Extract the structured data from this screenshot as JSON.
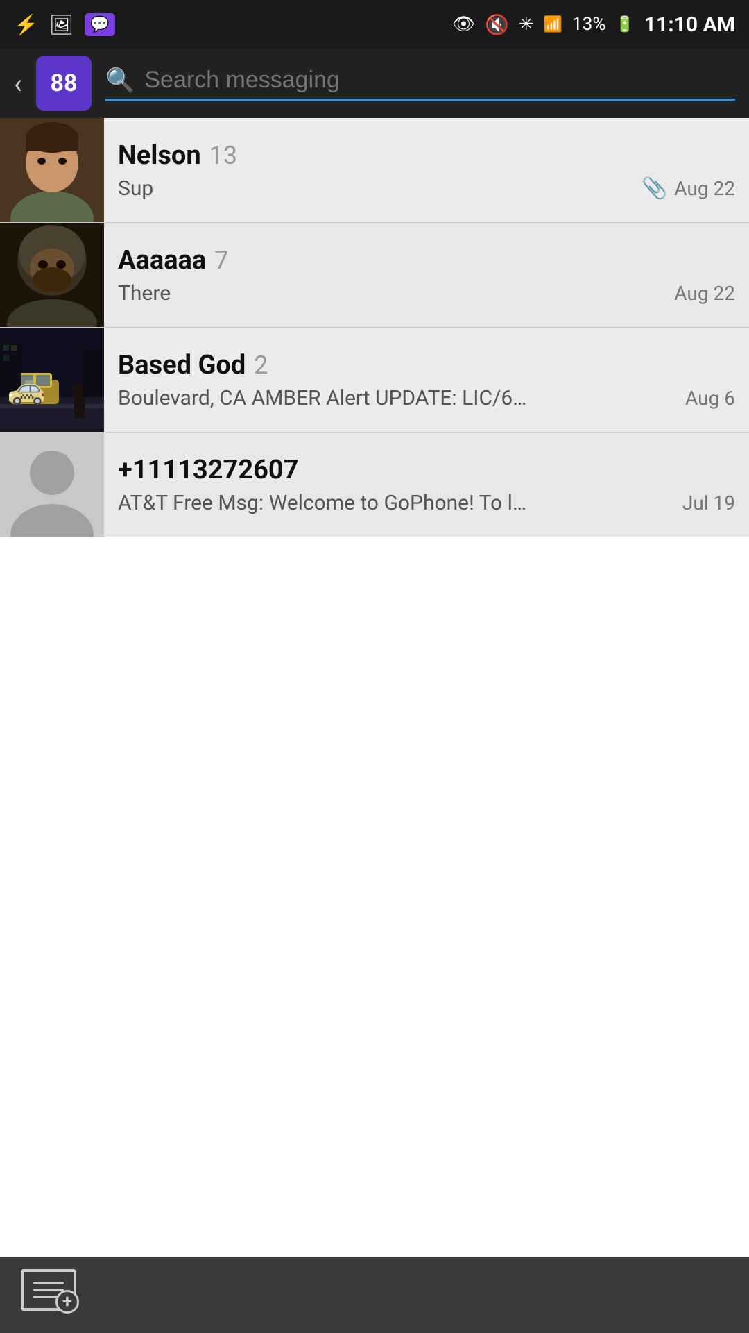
{
  "statusBar": {
    "time": "11:10 AM",
    "battery": "13%",
    "icons": [
      "usb",
      "image",
      "stream",
      "eye-slash",
      "mute",
      "bluetooth",
      "signal"
    ]
  },
  "header": {
    "backLabel": "‹",
    "badgeCount": "88",
    "searchPlaceholder": "Search messaging"
  },
  "conversations": [
    {
      "id": "nelson",
      "name": "Nelson",
      "unread": "13",
      "preview": "Sup",
      "date": "Aug 22",
      "hasAttachment": true,
      "avatarType": "nelson"
    },
    {
      "id": "aaaaaa",
      "name": "Aaaaaa",
      "unread": "7",
      "preview": "There",
      "date": "Aug 22",
      "hasAttachment": false,
      "avatarType": "aaaaaa"
    },
    {
      "id": "basedgod",
      "name": "Based God",
      "unread": "2",
      "preview": "Boulevard, CA AMBER Alert UPDATE: LIC/6…",
      "date": "Aug 6",
      "hasAttachment": false,
      "avatarType": "basedgod"
    },
    {
      "id": "unknown",
      "name": "+11113272607",
      "unread": "",
      "preview": "AT&T Free Msg: Welcome to GoPhone! To l…",
      "date": "Jul 19",
      "hasAttachment": false,
      "avatarType": "unknown"
    }
  ],
  "bottomBar": {
    "composeLabel": "Compose"
  }
}
